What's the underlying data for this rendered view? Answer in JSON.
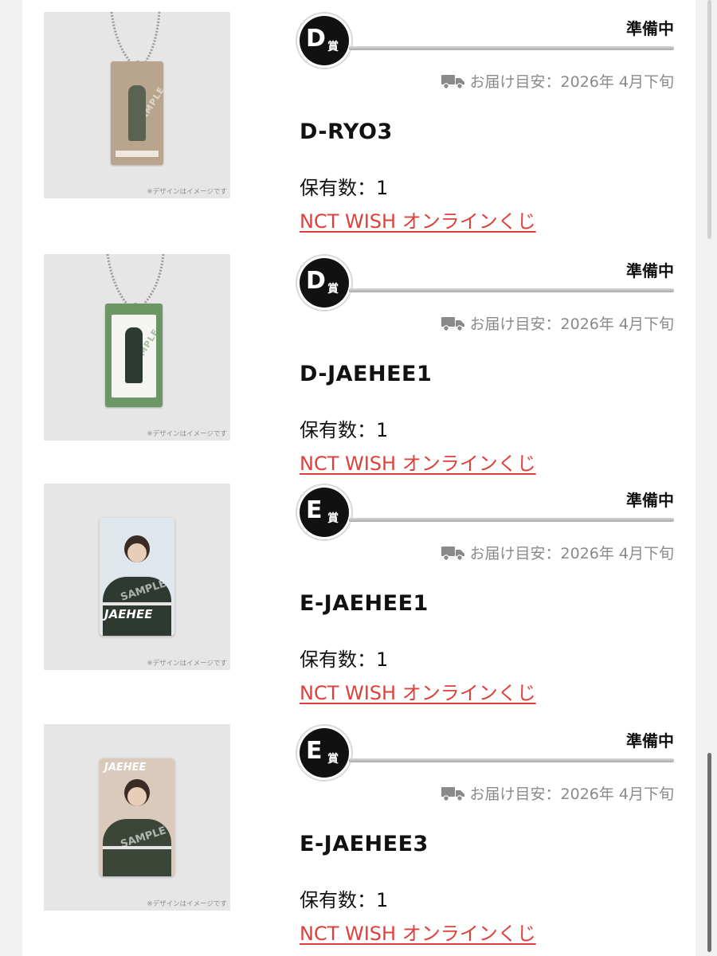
{
  "note_text": "※デザインはイメージです",
  "status_label": "準備中",
  "delivery_label": "お届け目安：2026年 4月下旬",
  "count_label": "保有数：1",
  "link_label": "NCT WISH オンラインくじ",
  "colors": {
    "link": "#e0403b",
    "status": "#111111",
    "muted": "#8a8a8a"
  },
  "items": [
    {
      "prize_letter": "D",
      "prize_suffix": "賞",
      "code": "D-RYO3",
      "art": "keychain-beige",
      "icon": "truck-icon"
    },
    {
      "prize_letter": "D",
      "prize_suffix": "賞",
      "code": "D-JAEHEE1",
      "art": "keychain-green",
      "icon": "truck-icon"
    },
    {
      "prize_letter": "E",
      "prize_suffix": "賞",
      "code": "E-JAEHEE1",
      "art": "card-blue",
      "card_name": "JAEHEE",
      "icon": "truck-icon"
    },
    {
      "prize_letter": "E",
      "prize_suffix": "賞",
      "code": "E-JAEHEE3",
      "art": "card-beige",
      "card_name": "JAEHEE",
      "icon": "truck-icon"
    }
  ]
}
